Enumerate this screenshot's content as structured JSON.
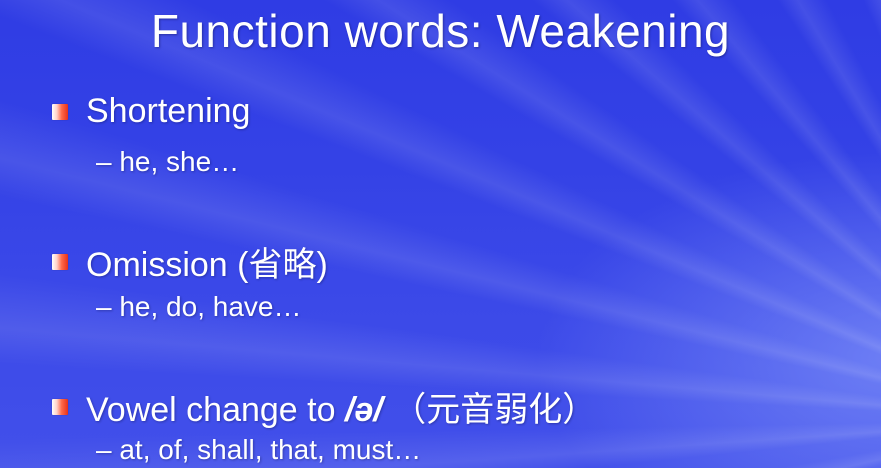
{
  "slide": {
    "title": "Function words: Weakening",
    "bullets": [
      {
        "label": "Shortening",
        "sub": "– he, she…"
      },
      {
        "label": "Omission (省略)",
        "sub": "– he, do, have…"
      },
      {
        "label_prefix": "Vowel change to ",
        "label_ipa": "/ə/",
        "label_suffix": " （元音弱化）",
        "sub": "– at, of, shall, that, must…"
      }
    ]
  }
}
